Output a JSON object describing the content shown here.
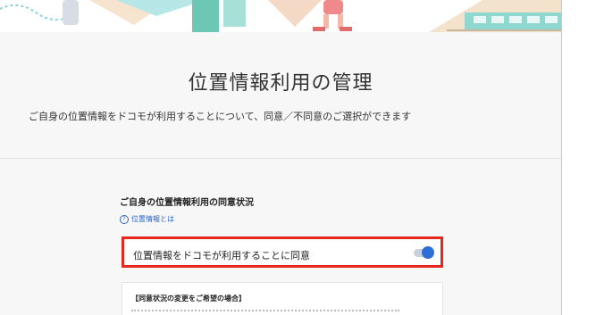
{
  "page": {
    "title": "位置情報利用の管理",
    "subtitle": "ご自身の位置情報をドコモが利用することについて、同意／不同意のご選択ができます"
  },
  "consent_section": {
    "heading": "ご自身の位置情報利用の同意状況",
    "help_link_label": "位置情報とは",
    "help_icon": "question-circle-icon",
    "consent_label": "位置情報をドコモが利用することに同意",
    "consent_enabled": true
  },
  "info_box": {
    "heading": "【同意状況の変更をご希望の場合】"
  },
  "colors": {
    "highlight_border": "#e5271c",
    "toggle_on": "#2e6fd6",
    "link": "#2f63c4"
  }
}
